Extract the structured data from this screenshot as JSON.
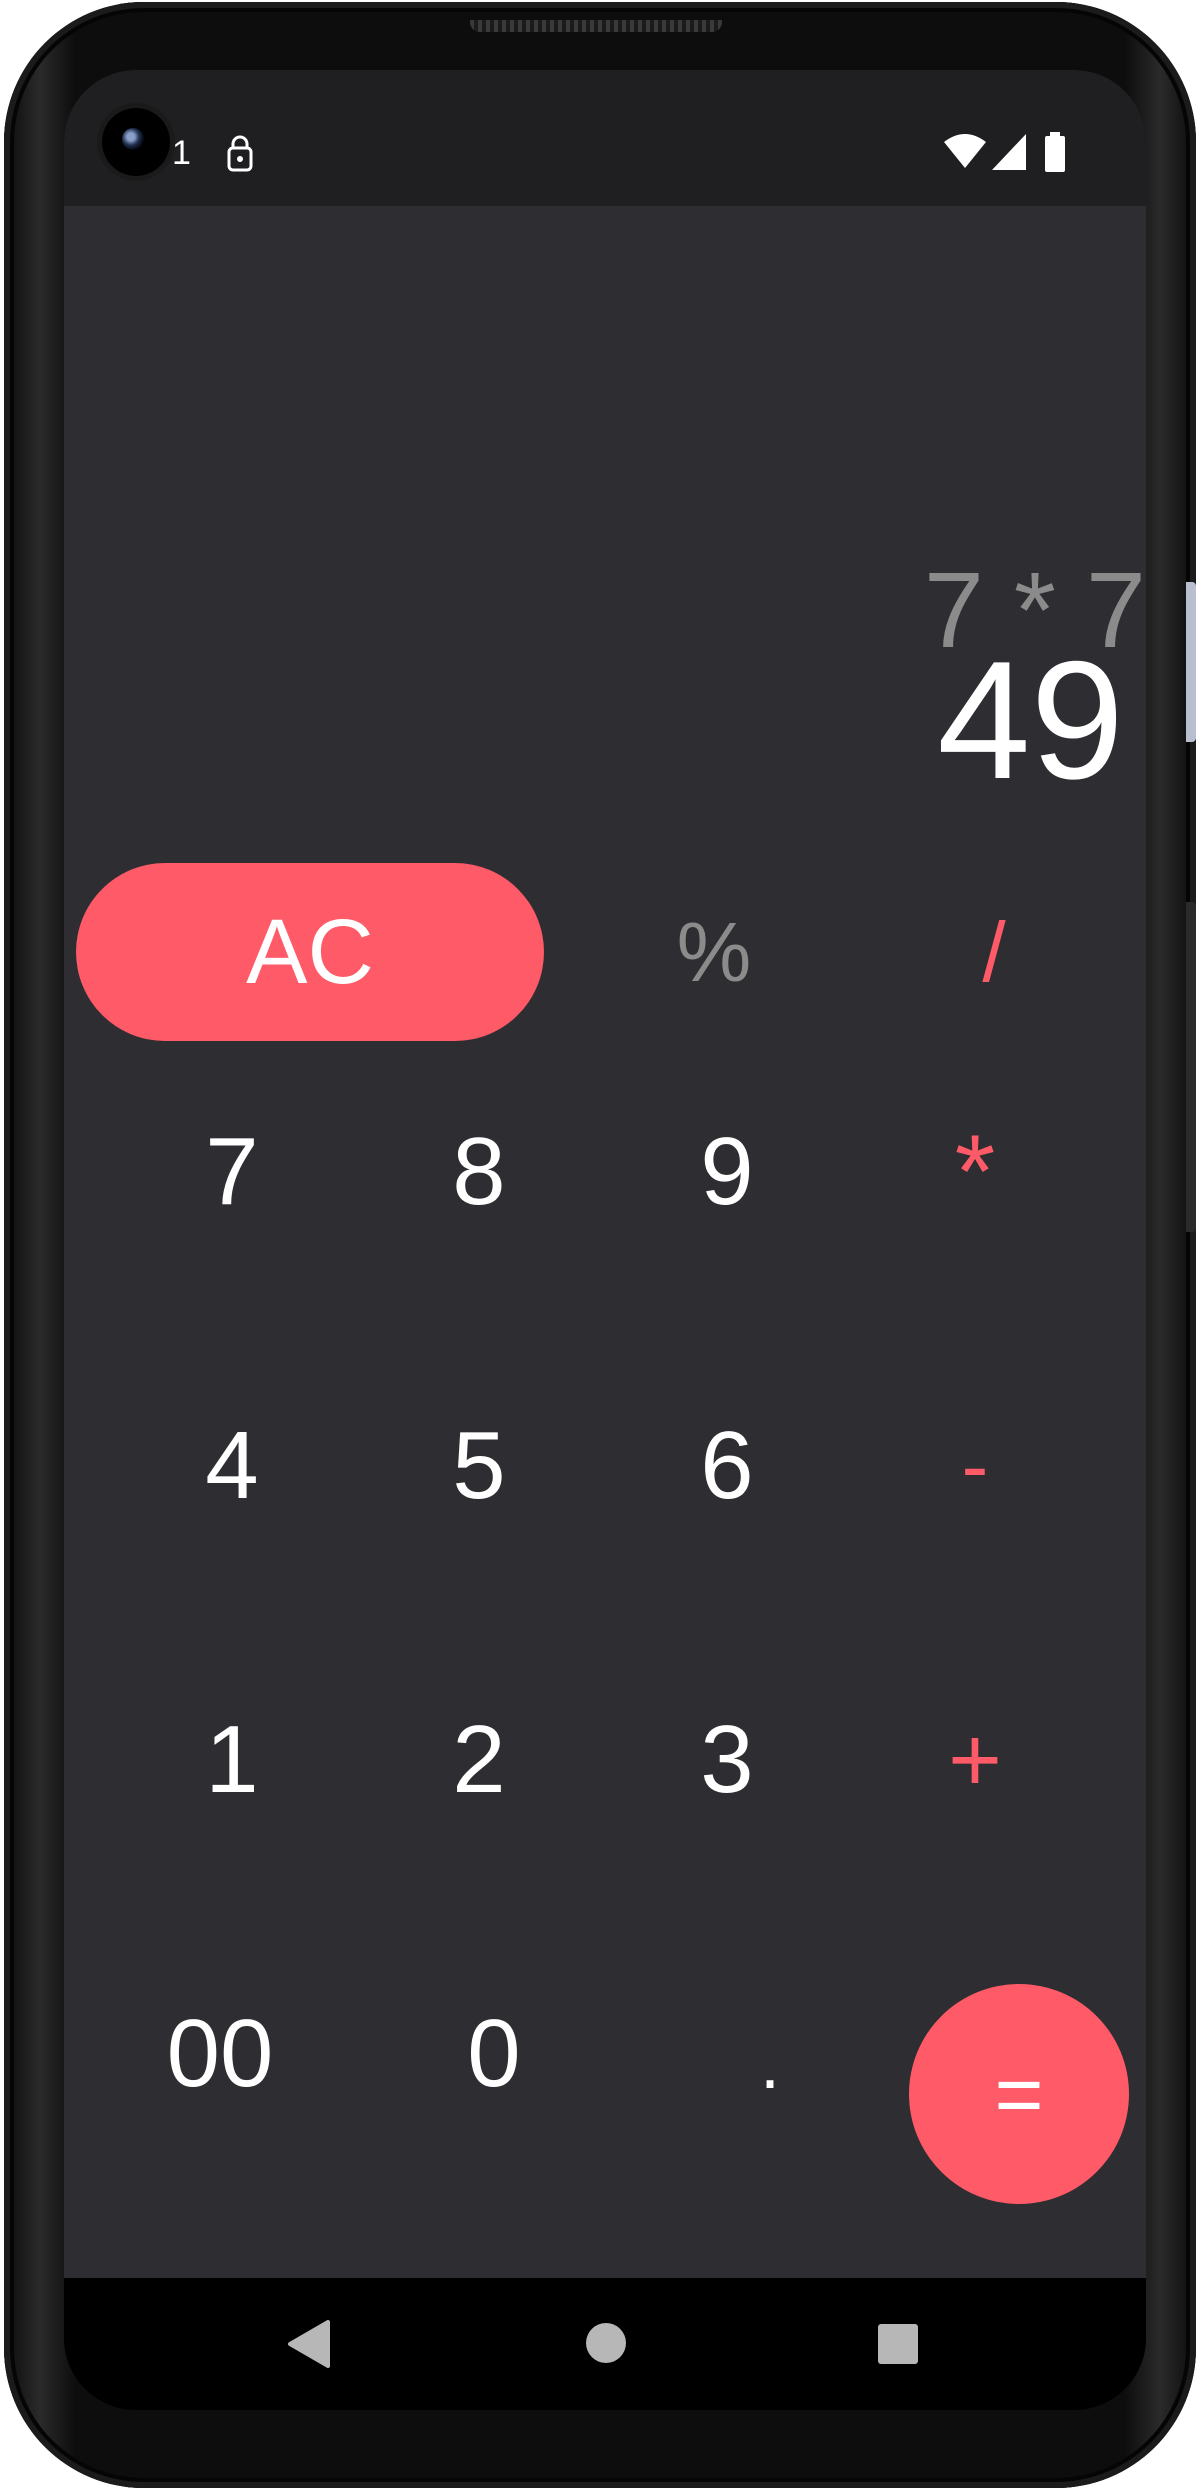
{
  "status_bar": {
    "time": "1",
    "icons": [
      "vpn-key-icon",
      "wifi-icon",
      "cellular-signal-icon",
      "battery-icon"
    ]
  },
  "display": {
    "expression": "7 * 7",
    "result": "49"
  },
  "keypad": {
    "clear": "AC",
    "percent": "%",
    "divide": "/",
    "seven": "7",
    "eight": "8",
    "nine": "9",
    "multiply": "*",
    "four": "4",
    "five": "5",
    "six": "6",
    "subtract": "-",
    "one": "1",
    "two": "2",
    "three": "3",
    "add": "+",
    "double_zero": "00",
    "zero": "0",
    "decimal": ".",
    "equals": "="
  },
  "navigation": {
    "icons": [
      "back-icon",
      "home-icon",
      "recents-icon"
    ]
  },
  "colors": {
    "accent": "#ff5a67",
    "background": "#2e2d31",
    "muted_text": "#8b8b8b",
    "text": "#ffffff"
  }
}
